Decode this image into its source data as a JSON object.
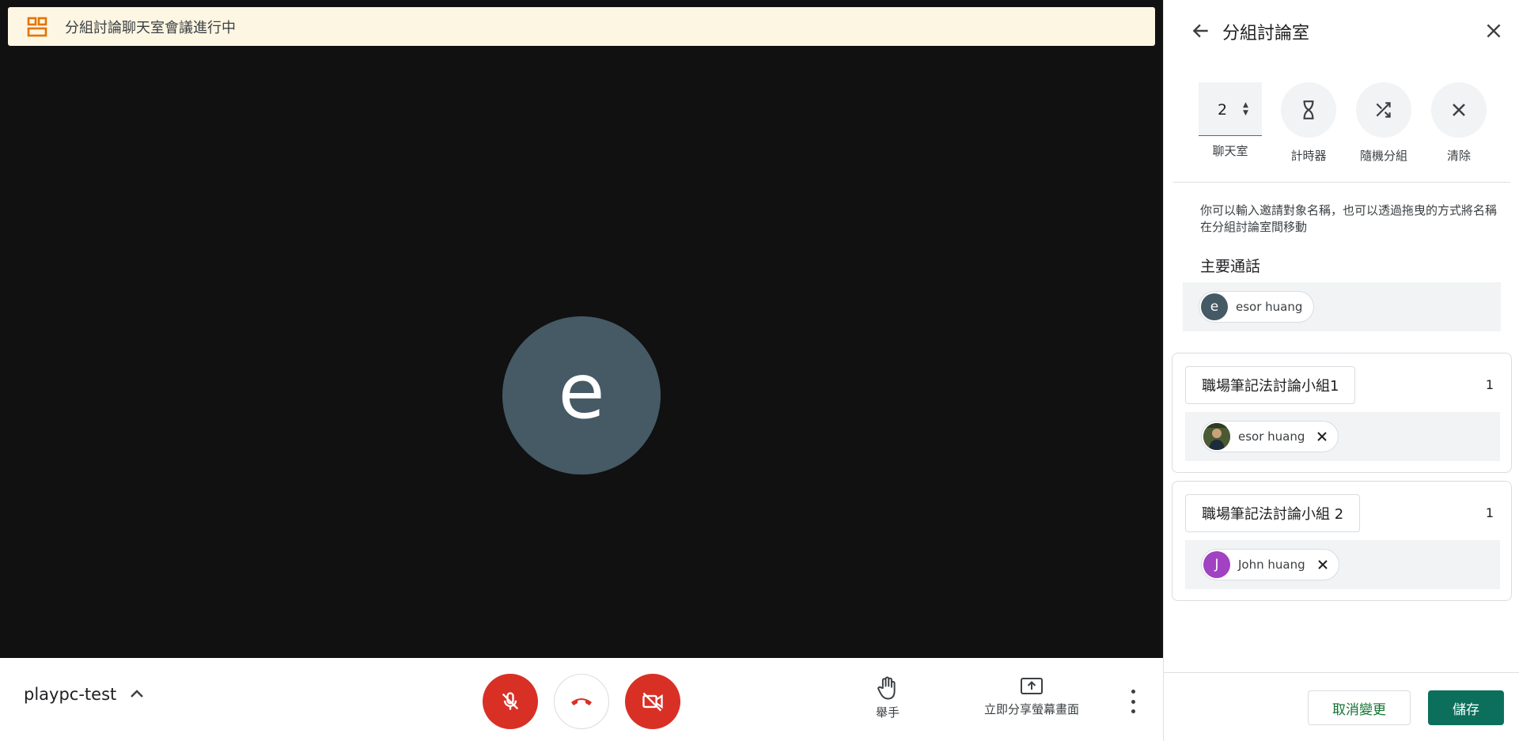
{
  "banner": {
    "text": "分組討論聊天室會議進行中",
    "icon": "breakout-rooms-icon",
    "accent": "#e37400"
  },
  "stage": {
    "participant_initial": "e",
    "avatar_color": "#455a64"
  },
  "bottom_bar": {
    "meeting_name": "playpc-test",
    "controls": {
      "mic": "mic-off-icon",
      "hangup": "call-end-icon",
      "camera": "camera-off-icon"
    },
    "raise_hand_label": "舉手",
    "present_label": "立即分享螢幕畫面"
  },
  "panel": {
    "title": "分組討論室",
    "room_count": "2",
    "room_count_label": "聊天室",
    "timer_label": "計時器",
    "shuffle_label": "隨機分組",
    "clear_label": "清除",
    "hint": "你可以輸入邀請對象名稱，也可以透過拖曳的方式將名稱在分組討論室間移動",
    "main_call_title": "主要通話",
    "main_call_members": [
      {
        "initial": "e",
        "name": "esor huang",
        "color": "#455a64"
      }
    ],
    "rooms": [
      {
        "name": "職場筆記法討論小組1",
        "count": "1",
        "members": [
          {
            "initial": "",
            "name": "esor huang",
            "color": "#3b4a2f",
            "photo": true
          }
        ]
      },
      {
        "name": "職場筆記法討論小組 2",
        "count": "1",
        "members": [
          {
            "initial": "J",
            "name": "John huang",
            "color": "#a142c2"
          }
        ]
      }
    ],
    "cancel_label": "取消變更",
    "save_label": "儲存",
    "colors": {
      "primary": "#0b6f5c",
      "danger": "#d93025"
    }
  }
}
